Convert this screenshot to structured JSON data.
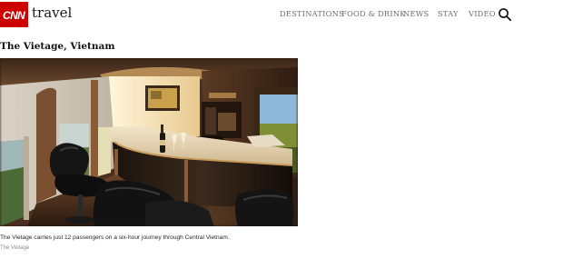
{
  "brand": {
    "logo_text": "CNN",
    "section": "travel",
    "logo_color": "#cc0000"
  },
  "nav": {
    "items": [
      "DESTINATIONS",
      "FOOD & DRINK",
      "NEWS",
      "STAY",
      "VIDEO"
    ],
    "search_icon": "search-icon"
  },
  "article": {
    "title": "The Vietage, Vietnam",
    "image_description_icon": "photo",
    "caption": "The Vietage carries just 12 passengers on a six-hour journey through Central Vietnam.",
    "credit": "The Vietage"
  }
}
